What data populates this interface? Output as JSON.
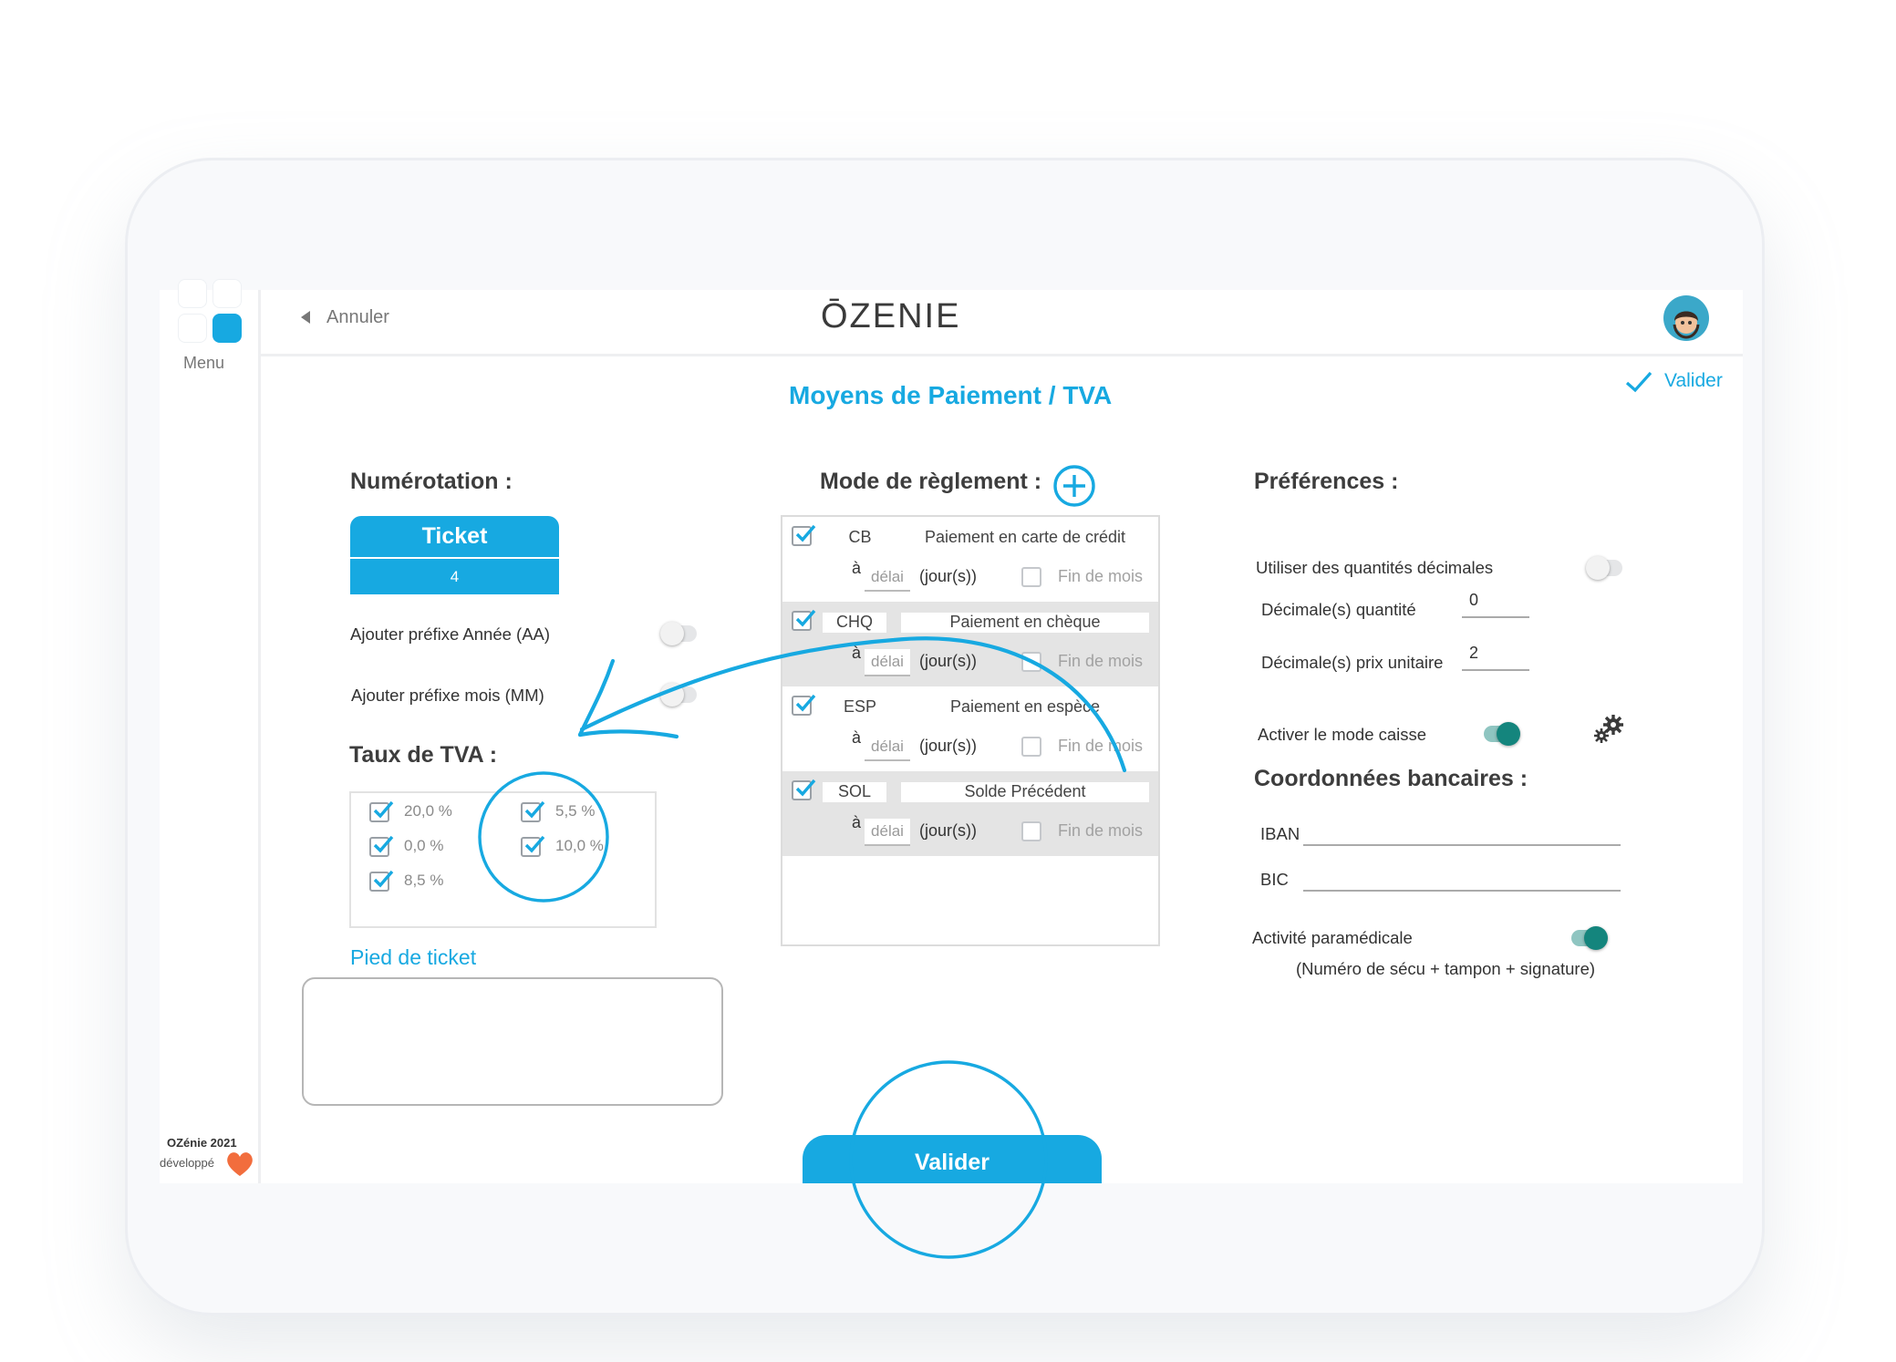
{
  "leftbar": {
    "menu_label": "Menu",
    "footer_brand": "OZénie 2021",
    "footer_dev": "développé"
  },
  "header": {
    "cancel_label": "Annuler",
    "brand": "ŌZENIE",
    "validate_label": "Valider"
  },
  "page_title": "Moyens de Paiement / TVA",
  "numerotation": {
    "title": "Numérotation :",
    "ticket_label": "Ticket",
    "ticket_number": "4",
    "prefix_year_label": "Ajouter préfixe Année (AA)",
    "prefix_month_label": "Ajouter préfixe mois (MM)",
    "prefix_year_on": false,
    "prefix_month_on": false
  },
  "tva": {
    "title": "Taux de TVA :",
    "rates": [
      {
        "label": "20,0 %",
        "checked": true
      },
      {
        "label": "0,0 %",
        "checked": true
      },
      {
        "label": "8,5 %",
        "checked": true
      },
      {
        "label": "5,5 %",
        "checked": true
      },
      {
        "label": "10,0 %",
        "checked": true
      }
    ]
  },
  "footer_ticket": {
    "label": "Pied de ticket",
    "value": ""
  },
  "modes": {
    "title": "Mode de règlement :",
    "add_icon": "plus-circle-icon",
    "a_label": "à",
    "delai_placeholder": "délai",
    "jours_label": "(jour(s))",
    "fin_label": "Fin de mois",
    "rows": [
      {
        "code": "CB",
        "description": "Paiement en carte de crédit",
        "checked": true,
        "fin": false
      },
      {
        "code": "CHQ",
        "description": "Paiement en chèque",
        "checked": true,
        "fin": false
      },
      {
        "code": "ESP",
        "description": "Paiement en espèce",
        "checked": true,
        "fin": false
      },
      {
        "code": "SOL",
        "description": "Solde Précédent",
        "checked": true,
        "fin": false
      }
    ]
  },
  "preferences": {
    "title": "Préférences :",
    "decimal_label": "Utiliser des quantités décimales",
    "decimal_on": false,
    "qty_label": "Décimale(s) quantité",
    "qty_value": "0",
    "price_label": "Décimale(s) prix unitaire",
    "price_value": "2",
    "cash_label": "Activer le mode caisse",
    "cash_on": true,
    "settings_icon": "gears-icon"
  },
  "bank": {
    "title": "Coordonnées bancaires :",
    "iban_label": "IBAN",
    "iban_value": "",
    "bic_label": "BIC",
    "bic_value": ""
  },
  "paramedical": {
    "label": "Activité paramédicale",
    "note": "(Numéro de sécu + tampon + signature)",
    "on": true
  },
  "validate_button": "Valider",
  "colors": {
    "accent": "#17a9e1",
    "toggle_on": "#14857d"
  }
}
